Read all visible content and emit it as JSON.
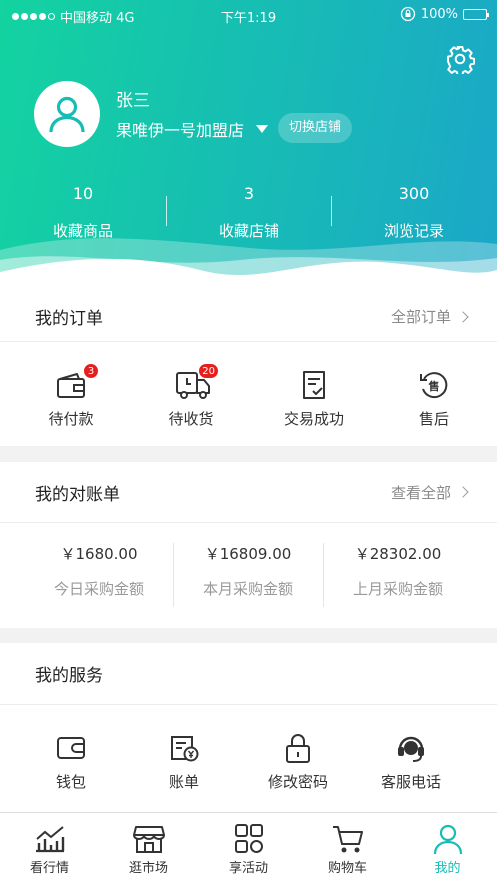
{
  "status_bar": {
    "carrier": "中国移动 4G",
    "time": "下午1:19",
    "battery": "100%"
  },
  "profile": {
    "name": "张三",
    "store": "果唯伊一号加盟店",
    "switch_label": "切换店铺"
  },
  "stats": [
    {
      "value": "10",
      "label": "收藏商品"
    },
    {
      "value": "3",
      "label": "收藏店铺"
    },
    {
      "value": "300",
      "label": "浏览记录"
    }
  ],
  "orders": {
    "title": "我的订单",
    "more": "全部订单",
    "items": [
      {
        "label": "待付款",
        "badge": "3",
        "icon": "wallet-icon"
      },
      {
        "label": "待收货",
        "badge": "20",
        "icon": "delivery-truck-icon"
      },
      {
        "label": "交易成功",
        "icon": "receipt-check-icon"
      },
      {
        "label": "售后",
        "icon": "after-sale-icon"
      }
    ]
  },
  "statements": {
    "title": "我的对账单",
    "more": "查看全部",
    "items": [
      {
        "value": "￥1680.00",
        "label": "今日采购金额"
      },
      {
        "value": "￥16809.00",
        "label": "本月采购金额"
      },
      {
        "value": "￥28302.00",
        "label": "上月采购金额"
      }
    ]
  },
  "services": {
    "title": "我的服务",
    "items": [
      {
        "label": "钱包",
        "icon": "wallet-icon"
      },
      {
        "label": "账单",
        "icon": "bill-icon"
      },
      {
        "label": "修改密码",
        "icon": "lock-icon"
      },
      {
        "label": "客服电话",
        "icon": "headset-icon"
      }
    ]
  },
  "tabs": [
    {
      "label": "看行情",
      "icon": "chart-icon"
    },
    {
      "label": "逛市场",
      "icon": "store-icon"
    },
    {
      "label": "享活动",
      "icon": "grid-icon"
    },
    {
      "label": "购物车",
      "icon": "cart-icon"
    },
    {
      "label": "我的",
      "icon": "user-icon",
      "active": true
    }
  ],
  "colors": {
    "accent": "#17bdb5",
    "gradient_start": "#13d3a0",
    "gradient_end": "#1ba7c8",
    "badge": "#e5201c"
  }
}
